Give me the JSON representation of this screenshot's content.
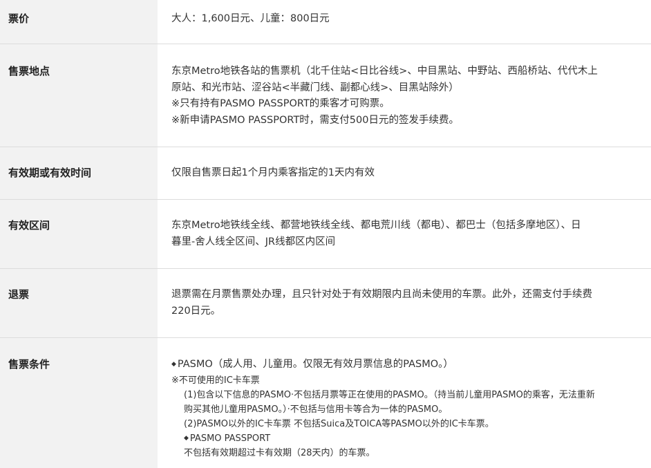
{
  "rows": [
    {
      "label": "票价",
      "lines": [
        "大人：1,600日元、儿童：800日元"
      ]
    },
    {
      "label": "售票地点",
      "lines": [
        "东京Metro地铁各站的售票机（北千住站<日比谷线>、中目黑站、中野站、西船桥站、代代木上",
        "原站、和光市站、涩谷站<半藏门线、副都心线>、目黑站除外）",
        "※只有持有PASMO PASSPORT的乘客才可购票。",
        "※新申请PASMO PASSPORT时，需支付500日元的签发手续费。"
      ]
    },
    {
      "label": "有效期或有效时间",
      "lines": [
        "仅限自售票日起1个月内乘客指定的1天内有效"
      ]
    },
    {
      "label": "有效区间",
      "lines": [
        "东京Metro地铁线全线、都营地铁线全线、都电荒川线（都电）、都巴士（包括多摩地区）、日",
        "暮里-舍人线全区间、JR线都区内区间"
      ]
    },
    {
      "label": "退票",
      "lines": [
        "退票需在月票售票处办理，且只针对处于有效期限内且尚未使用的车票。此外，还需支付手续费",
        "220日元。"
      ]
    },
    {
      "label": "售票条件",
      "main": "PASMO（成人用、儿童用。仅限无有效月票信息的PASMO。）",
      "sub": {
        "note": "※不可使用的IC卡车票",
        "line1a": "(1)包含以下信息的PASMO·不包括月票等正在使用的PASMO。（持当前儿童用PASMO的乘客，无法重新",
        "line1b": "购买其他儿童用PASMO。）·不包括与信用卡等合为一体的PASMO。",
        "line2": "(2)PASMO以外的IC卡车票 不包括Suica及TOICA等PASMO以外的IC卡车票。",
        "passport": "PASMO PASSPORT",
        "passport_note": "不包括有效期超过卡有效期（28天内）的车票。"
      }
    }
  ],
  "icons": {
    "bullet": "diamond-bullet-icon"
  }
}
